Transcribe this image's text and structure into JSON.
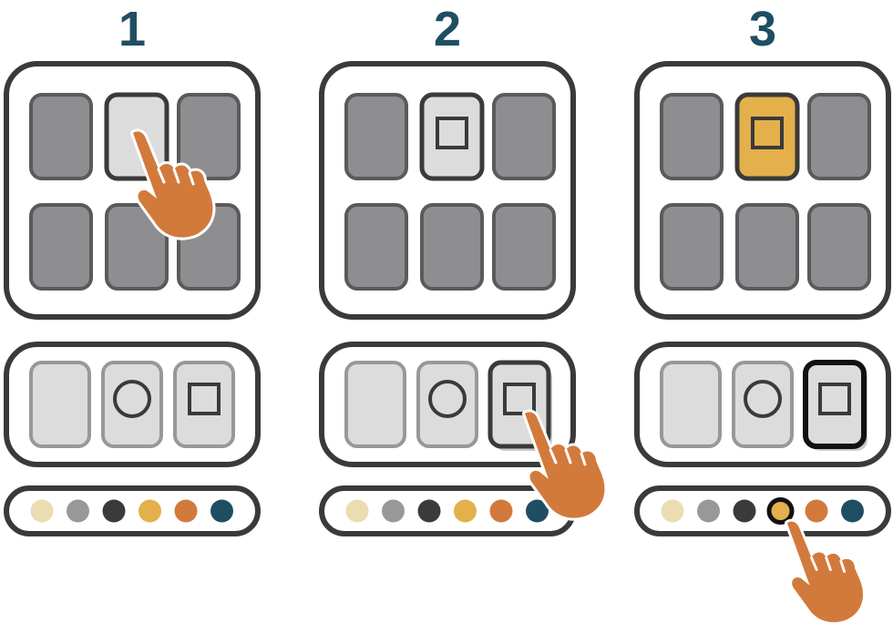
{
  "colors": {
    "frame": "#3a3a3a",
    "tile_dark": "#8e8e91",
    "tile_light": "#dcdcdc",
    "selected_fill": "#e3b04b",
    "step_number": "#1f4e63",
    "hand": "#d27a3c"
  },
  "palette": [
    "#ecdcb2",
    "#98989a",
    "#3a3a3a",
    "#e3b04b",
    "#d27a3c",
    "#1f4e63"
  ],
  "steps": [
    {
      "number": "1",
      "grid_tiles": [
        {
          "fill": "dark",
          "shape": "none"
        },
        {
          "fill": "light",
          "shape": "none"
        },
        {
          "fill": "dark",
          "shape": "none"
        },
        {
          "fill": "dark",
          "shape": "none"
        },
        {
          "fill": "dark",
          "shape": "none"
        },
        {
          "fill": "dark",
          "shape": "none"
        }
      ],
      "shape_options": [
        {
          "shape": "none",
          "state": "normal"
        },
        {
          "shape": "circle",
          "state": "normal"
        },
        {
          "shape": "square",
          "state": "normal"
        }
      ],
      "selected_color_index": -1,
      "pointer_target": "grid-tile-2"
    },
    {
      "number": "2",
      "grid_tiles": [
        {
          "fill": "dark",
          "shape": "none"
        },
        {
          "fill": "light",
          "shape": "square"
        },
        {
          "fill": "dark",
          "shape": "none"
        },
        {
          "fill": "dark",
          "shape": "none"
        },
        {
          "fill": "dark",
          "shape": "none"
        },
        {
          "fill": "dark",
          "shape": "none"
        }
      ],
      "shape_options": [
        {
          "shape": "none",
          "state": "normal"
        },
        {
          "shape": "circle",
          "state": "normal"
        },
        {
          "shape": "square",
          "state": "pressed"
        }
      ],
      "selected_color_index": -1,
      "pointer_target": "shape-option-square"
    },
    {
      "number": "3",
      "grid_tiles": [
        {
          "fill": "dark",
          "shape": "none"
        },
        {
          "fill": "accent",
          "shape": "square"
        },
        {
          "fill": "dark",
          "shape": "none"
        },
        {
          "fill": "dark",
          "shape": "none"
        },
        {
          "fill": "dark",
          "shape": "none"
        },
        {
          "fill": "dark",
          "shape": "none"
        }
      ],
      "shape_options": [
        {
          "shape": "none",
          "state": "normal"
        },
        {
          "shape": "circle",
          "state": "normal"
        },
        {
          "shape": "square",
          "state": "active"
        }
      ],
      "selected_color_index": 3,
      "pointer_target": "color-swatch-4"
    }
  ]
}
